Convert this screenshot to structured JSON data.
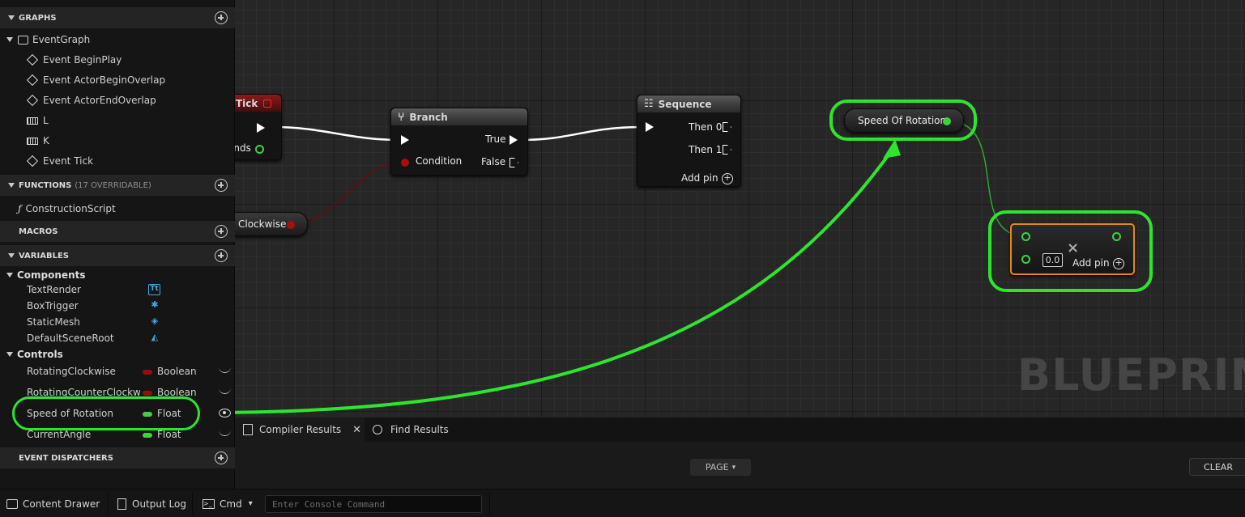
{
  "my_blueprint": {
    "graphs": {
      "label": "GRAPHS",
      "event_graph": "EventGraph",
      "events": [
        "Event BeginPlay",
        "Event ActorBeginOverlap",
        "Event ActorEndOverlap"
      ],
      "keys": [
        "L",
        "K"
      ],
      "tick": "Event Tick"
    },
    "functions": {
      "label": "FUNCTIONS",
      "sub": "(17 OVERRIDABLE)",
      "construction": "ConstructionScript"
    },
    "macros": {
      "label": "MACROS"
    },
    "variables": {
      "label": "VARIABLES",
      "components_group": "Components",
      "components": [
        "TextRender",
        "BoxTrigger",
        "StaticMesh",
        "DefaultSceneRoot"
      ],
      "controls_group": "Controls",
      "controls": [
        {
          "name": "RotatingClockwise",
          "type": "Boolean",
          "color": "#9a0b0b"
        },
        {
          "name": "RotatingCounterClockwise",
          "type": "Boolean",
          "color": "#9a0b0b"
        },
        {
          "name": "Speed of Rotation",
          "type": "Float",
          "color": "#3fd13f"
        },
        {
          "name": "CurrentAngle",
          "type": "Float",
          "color": "#3fd13f"
        }
      ]
    },
    "dispatchers": {
      "label": "EVENT DISPATCHERS"
    }
  },
  "graph": {
    "tick_node": {
      "title": "Tick",
      "pin": "onds"
    },
    "clockwise_node": {
      "label": "Clockwise"
    },
    "branch_node": {
      "title": "Branch",
      "condition": "Condition",
      "true": "True",
      "false": "False"
    },
    "sequence_node": {
      "title": "Sequence",
      "then0": "Then 0",
      "then1": "Then 1",
      "add_pin": "Add pin"
    },
    "speed_node": {
      "label": "Speed Of Rotation"
    },
    "multiply_node": {
      "value": "0.0",
      "add_pin": "Add pin"
    },
    "watermark": "BLUEPRINT",
    "colors": {
      "exec": "#ffffff",
      "bool": "#9a0b0b",
      "float": "#3fd13f",
      "highlight": "#2ee52e",
      "selected": "#e08a10"
    }
  },
  "results": {
    "tabs": [
      "Compiler Results",
      "Find Results"
    ],
    "page_button": "PAGE",
    "clear_button": "CLEAR"
  },
  "status_bar": {
    "content_drawer": "Content Drawer",
    "output_log": "Output Log",
    "cmd": "Cmd",
    "console_placeholder": "Enter Console Command"
  }
}
